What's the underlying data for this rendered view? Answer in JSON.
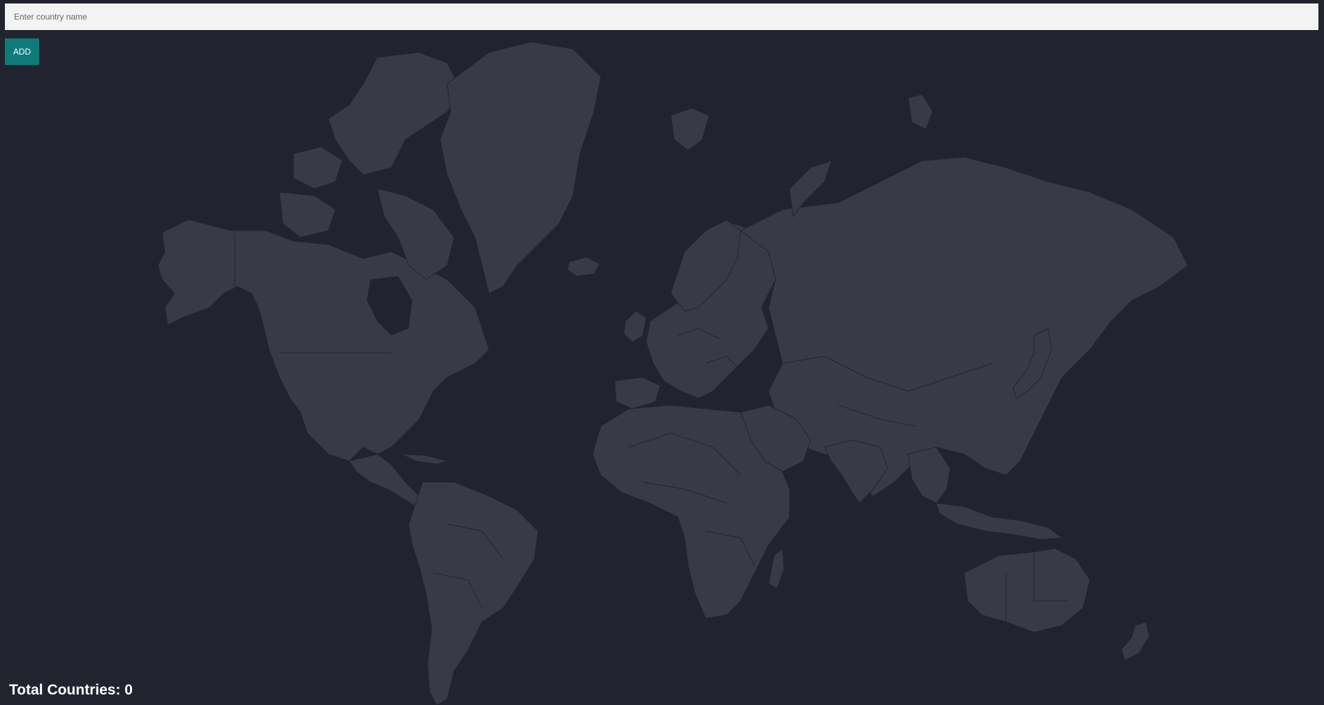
{
  "search": {
    "placeholder": "Enter country name",
    "value": ""
  },
  "add_button": {
    "label": "ADD"
  },
  "total": {
    "label": "Total Countries:",
    "count": "0"
  },
  "colors": {
    "background": "#21242e",
    "land": "#383b46",
    "border": "#23262f",
    "input_bg": "#f3f3f3",
    "button_bg": "#0f7b7a",
    "text": "#ffffff"
  }
}
